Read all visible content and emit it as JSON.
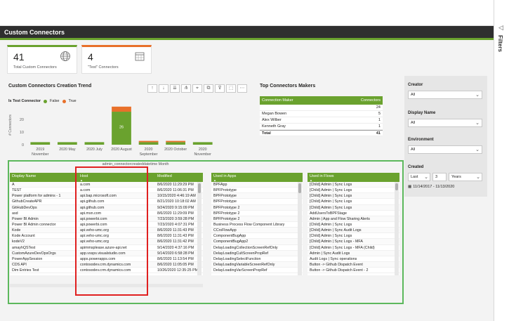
{
  "filters": {
    "label": "Filters",
    "icon": "chevron-left-icon"
  },
  "report": {
    "title": "Custom Connectors"
  },
  "kpis": [
    {
      "value": "41",
      "label": "Total Custom Connectors",
      "icon": "globe-icon",
      "accent": "#6aa22e"
    },
    {
      "value": "4",
      "label": "\"Test\" Connectors",
      "icon": "calendar-icon",
      "accent": "#e8702a"
    }
  ],
  "trend": {
    "title": "Custom Connectors Creation Trend",
    "legend_title": "Is Test Connector",
    "legend_false": "False",
    "legend_true": "True",
    "bar_label": "26",
    "toolbar": [
      "↑",
      "↓",
      "⇊",
      "⋔",
      "⌖",
      "⧉",
      "⊽",
      "⬚",
      "⋯"
    ]
  },
  "chart_data": {
    "type": "bar",
    "categories": [
      "2019 November",
      "2020 May",
      "2020 July",
      "2020 August",
      "2020 September",
      "2020 October",
      "2020 November"
    ],
    "category_lines": [
      [
        "2019",
        "November"
      ],
      [
        "2020 May",
        ""
      ],
      [
        "2020 July",
        ""
      ],
      [
        "2020 August",
        ""
      ],
      [
        "2020",
        "September"
      ],
      [
        "2020 October",
        ""
      ],
      [
        "2020",
        "November"
      ]
    ],
    "series": [
      {
        "name": "False",
        "values": [
          2,
          2,
          2,
          26,
          2,
          2,
          2
        ],
        "color": "#6aa22e"
      },
      {
        "name": "True",
        "values": [
          0,
          0,
          0,
          4,
          1,
          1,
          0
        ],
        "color": "#e8702a"
      }
    ],
    "xlabel": "admin_connectorcreateddatetime Month",
    "ylabel": "# Connectors",
    "yticks": [
      "0",
      "10",
      "20"
    ],
    "ylim": [
      0,
      31
    ]
  },
  "makers": {
    "title": "Top Connectors Makers",
    "col_maker": "Connection Maker",
    "col_count": "Connectors",
    "top_value": "24",
    "rows": [
      {
        "name": "Megan Bowen",
        "count": "5"
      },
      {
        "name": "Alex Wilber",
        "count": "1"
      },
      {
        "name": "Kenneth Gray",
        "count": "1"
      }
    ],
    "total_label": "Total",
    "total_value": "41"
  },
  "slicers": {
    "creator_label": "Creator",
    "creator_value": "All",
    "display_label": "Display Name",
    "display_value": "All",
    "env_label": "Environment",
    "env_value": "All",
    "created_label": "Created",
    "created_mode": "Last",
    "created_num": "3",
    "created_unit": "Years",
    "date_range": "11/14/2017 - 11/13/2020"
  },
  "connectors_table": {
    "headers": [
      "Display Name",
      "Host",
      "Modified"
    ],
    "rows": [
      [
        "A",
        "a.com",
        "8/6/2020 11:29:29 PM"
      ],
      [
        "TEST",
        "a.com",
        "8/6/2020 11:06:31 PM"
      ],
      [
        "Power platform for admins - 1",
        "api.bap.microsoft.com",
        "10/15/2020 4:46:19 AM"
      ],
      [
        "GithubCreateAPR",
        "api.github.com",
        "8/21/2020 10:18:02 AM"
      ],
      [
        "GitHubDevOps",
        "api.github.com",
        "9/24/2020 9:15:09 PM"
      ],
      [
        "asd",
        "api.msn.com",
        "8/6/2020 11:29:09 PM"
      ],
      [
        "Power BI Admin",
        "api.powerbi.com",
        "7/23/2020 3:59:28 PM"
      ],
      [
        "Power BI Admin connector",
        "api.powerbi.com",
        "7/23/2020 4:07:31 PM"
      ],
      [
        "Kode",
        "api.veho-umc.org",
        "8/6/2020 11:31:43 PM"
      ],
      [
        "Kode Account",
        "api.veho-umc.org",
        "8/6/2020 11:31:43 PM"
      ],
      [
        "kodeV2",
        "api.veho-umc.org",
        "8/6/2020 11:31:42 PM"
      ],
      [
        "amayhQSTest",
        "apimmsplease.azure-api.net",
        "9/14/2020 4:37:16 PM"
      ],
      [
        "CustomAzureDevOpsOrgs",
        "app.vssps.visualstudio.com",
        "9/14/2020 6:58:28 PM"
      ],
      [
        "PowerAppSession",
        "apps.powerapps.com",
        "8/6/2020 11:13:54 PM"
      ],
      [
        "CDS API",
        "contosodev.crm.dynamics.com",
        "8/6/2020 11:05:05 PM"
      ],
      [
        "Dim Entries Test",
        "contosodev.crm.dynamics.com",
        "10/26/2020 12:35:25 PM"
      ]
    ]
  },
  "apps_table": {
    "header": "Used in Apps",
    "rows": [
      "BPFApp",
      "BPFPrototype",
      "BPFPrototype",
      "BPFPrototype",
      "BPFPrototype 2",
      "BPFPrototype 2",
      "BPFPrototype 2",
      "Business Process Flow Component Library",
      "CCrsFlowApp",
      "ComponentBugApp",
      "ComponentBugApp2",
      "DelayLoadingCollectionScreenRefOnly",
      "DelayLoadingCultScreenPropRef",
      "DelayLoadingSelectFunction",
      "DelayLoadingVariableScreenRefOnly",
      "DelayLoadingVarScreenPropRef"
    ]
  },
  "flows_table": {
    "header": "Used in Flows",
    "rows": [
      "[Child] Admin | Sync Logs",
      "[Child] Admin | Sync Logs",
      "[Child] Admin | Sync Logs",
      "[Child] Admin | Sync Logs",
      "[Child] Admin | Sync Logs",
      "AddUsersToBPFStage",
      "Admin | App and Flow Sharing Alerts",
      "[Child] Admin | Sync Logs",
      "[Child] Admin | Sync Audit Logs",
      "[Child] Admin | Sync Logs",
      "[Child] Admin | Sync Logs - MFA",
      "[Child] Admin | Sync Logs - MFA (Child)",
      "Admin | Sync Audit Logs",
      "Audit Logs | Sync operations",
      "Button -> Github Dispatch Event",
      "Button -> Github Dispatch Event - 2"
    ]
  }
}
